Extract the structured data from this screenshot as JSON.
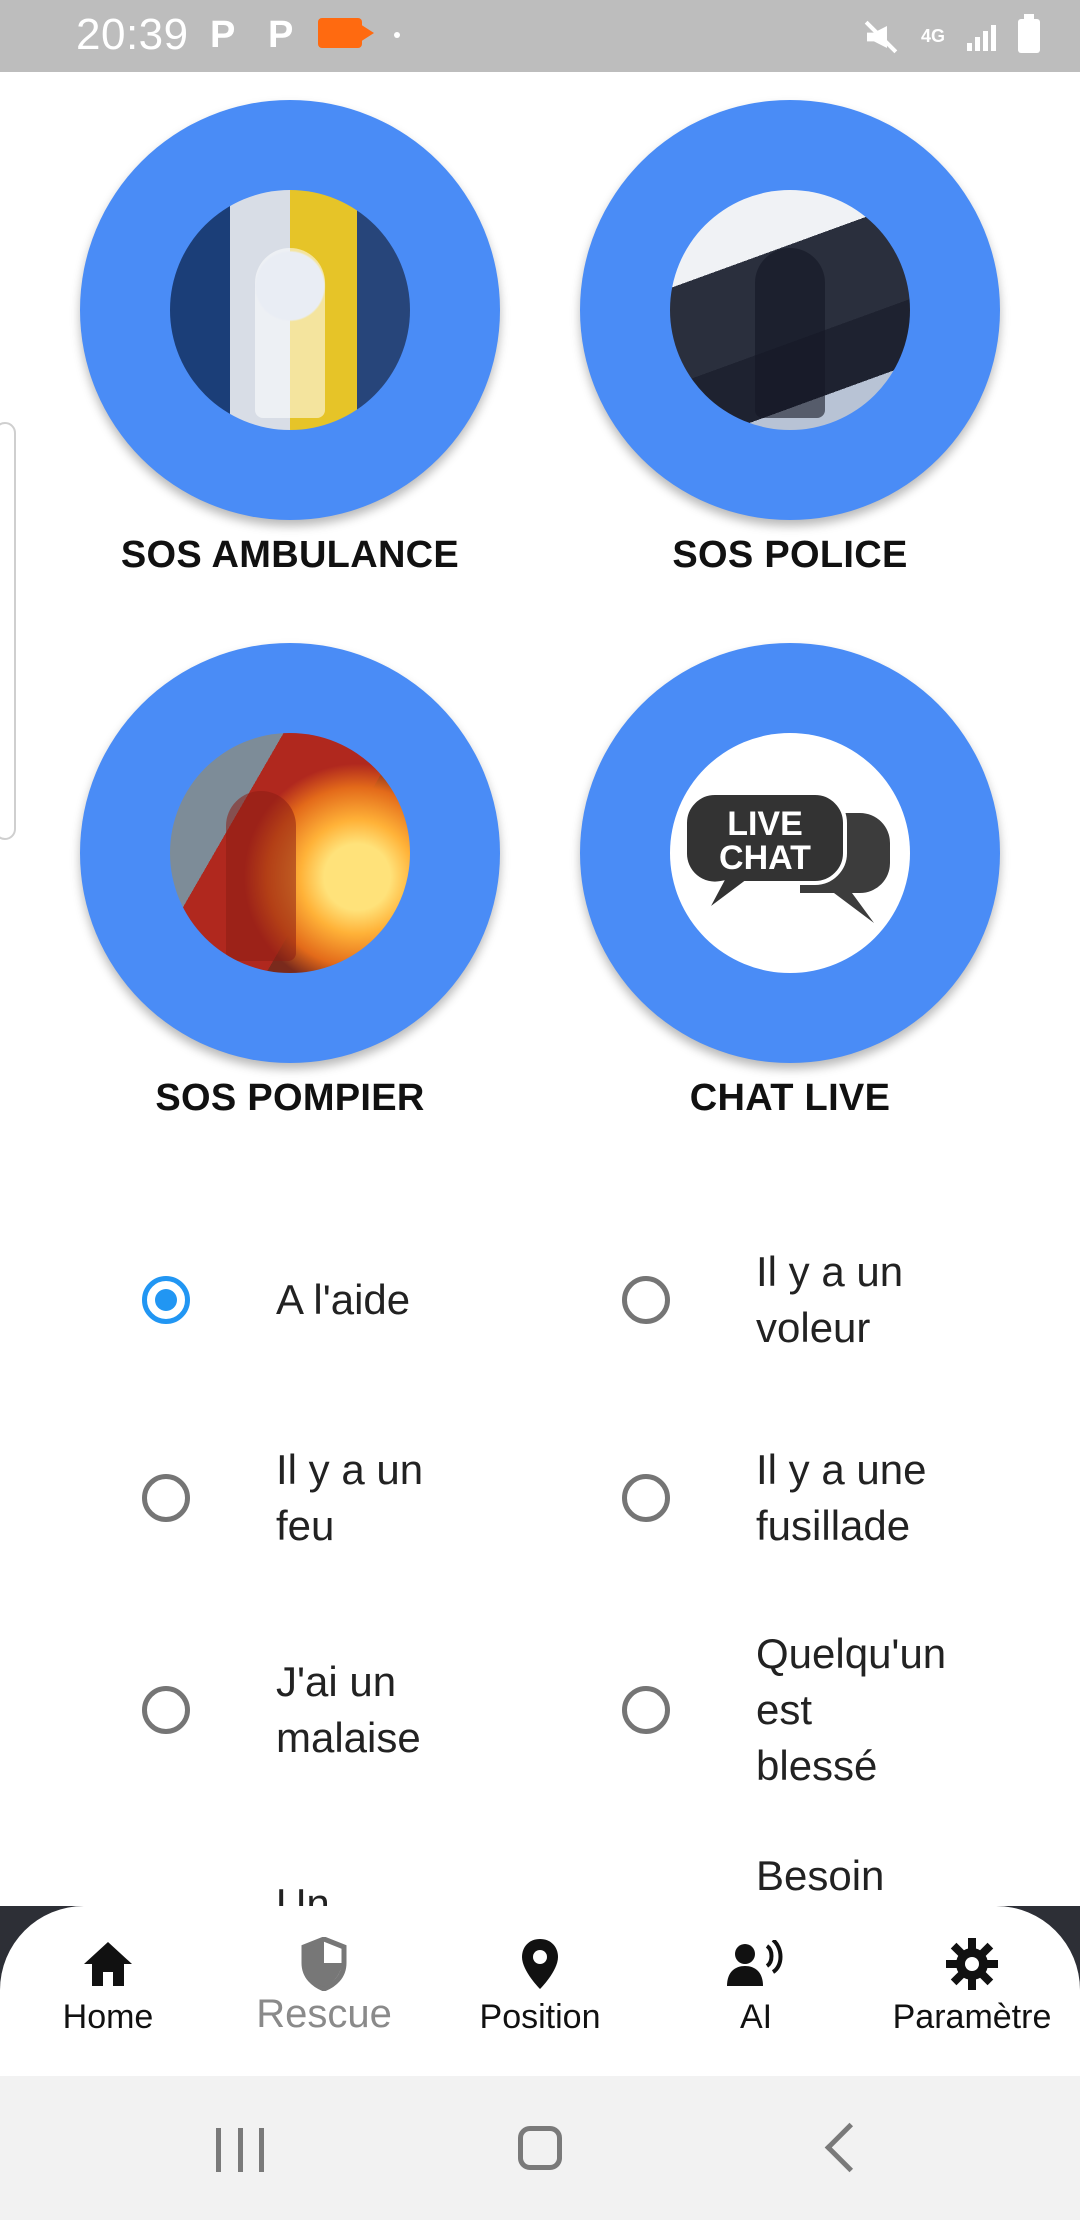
{
  "status_bar": {
    "time": "20:39",
    "p1": "P",
    "p2": "P",
    "network": "4G",
    "icons": [
      "parking-icon",
      "parking-icon",
      "video-record-icon",
      "mute-icon",
      "4g-icon",
      "signal-icon",
      "battery-icon"
    ]
  },
  "tiles": [
    {
      "label": "SOS AMBULANCE",
      "icon": "ambulance-photo"
    },
    {
      "label": "SOS POLICE",
      "icon": "police-photo"
    },
    {
      "label": "SOS POMPIER",
      "icon": "firefighter-photo"
    },
    {
      "label": "CHAT LIVE",
      "icon": "live-chat-icon",
      "badge_text": "LIVE CHAT"
    }
  ],
  "options": [
    {
      "label": "A l'aide",
      "checked": true
    },
    {
      "label": "Il y a un\nvoleur",
      "checked": false
    },
    {
      "label": "Il y a un\nfeu",
      "checked": false
    },
    {
      "label": "Il y a une\nfusillade",
      "checked": false
    },
    {
      "label": "J'ai un\nmalaise",
      "checked": false
    },
    {
      "label": "Quelqu'un\nest\nblessé",
      "checked": false
    },
    {
      "label": "Un",
      "checked": false
    },
    {
      "label": "Besoin",
      "checked": false
    }
  ],
  "nav": {
    "items": [
      {
        "label": "Home",
        "icon": "home-icon"
      },
      {
        "label": "Rescue",
        "icon": "shield-icon",
        "active": true
      },
      {
        "label": "Position",
        "icon": "location-pin-icon"
      },
      {
        "label": "AI",
        "icon": "voice-person-icon"
      },
      {
        "label": "Paramètre",
        "icon": "gear-icon"
      }
    ]
  },
  "colors": {
    "accent": "#4a8cf6",
    "radio_checked": "#2196f3",
    "status_bar": "#bdbdbd",
    "recording": "#ff6a10"
  }
}
